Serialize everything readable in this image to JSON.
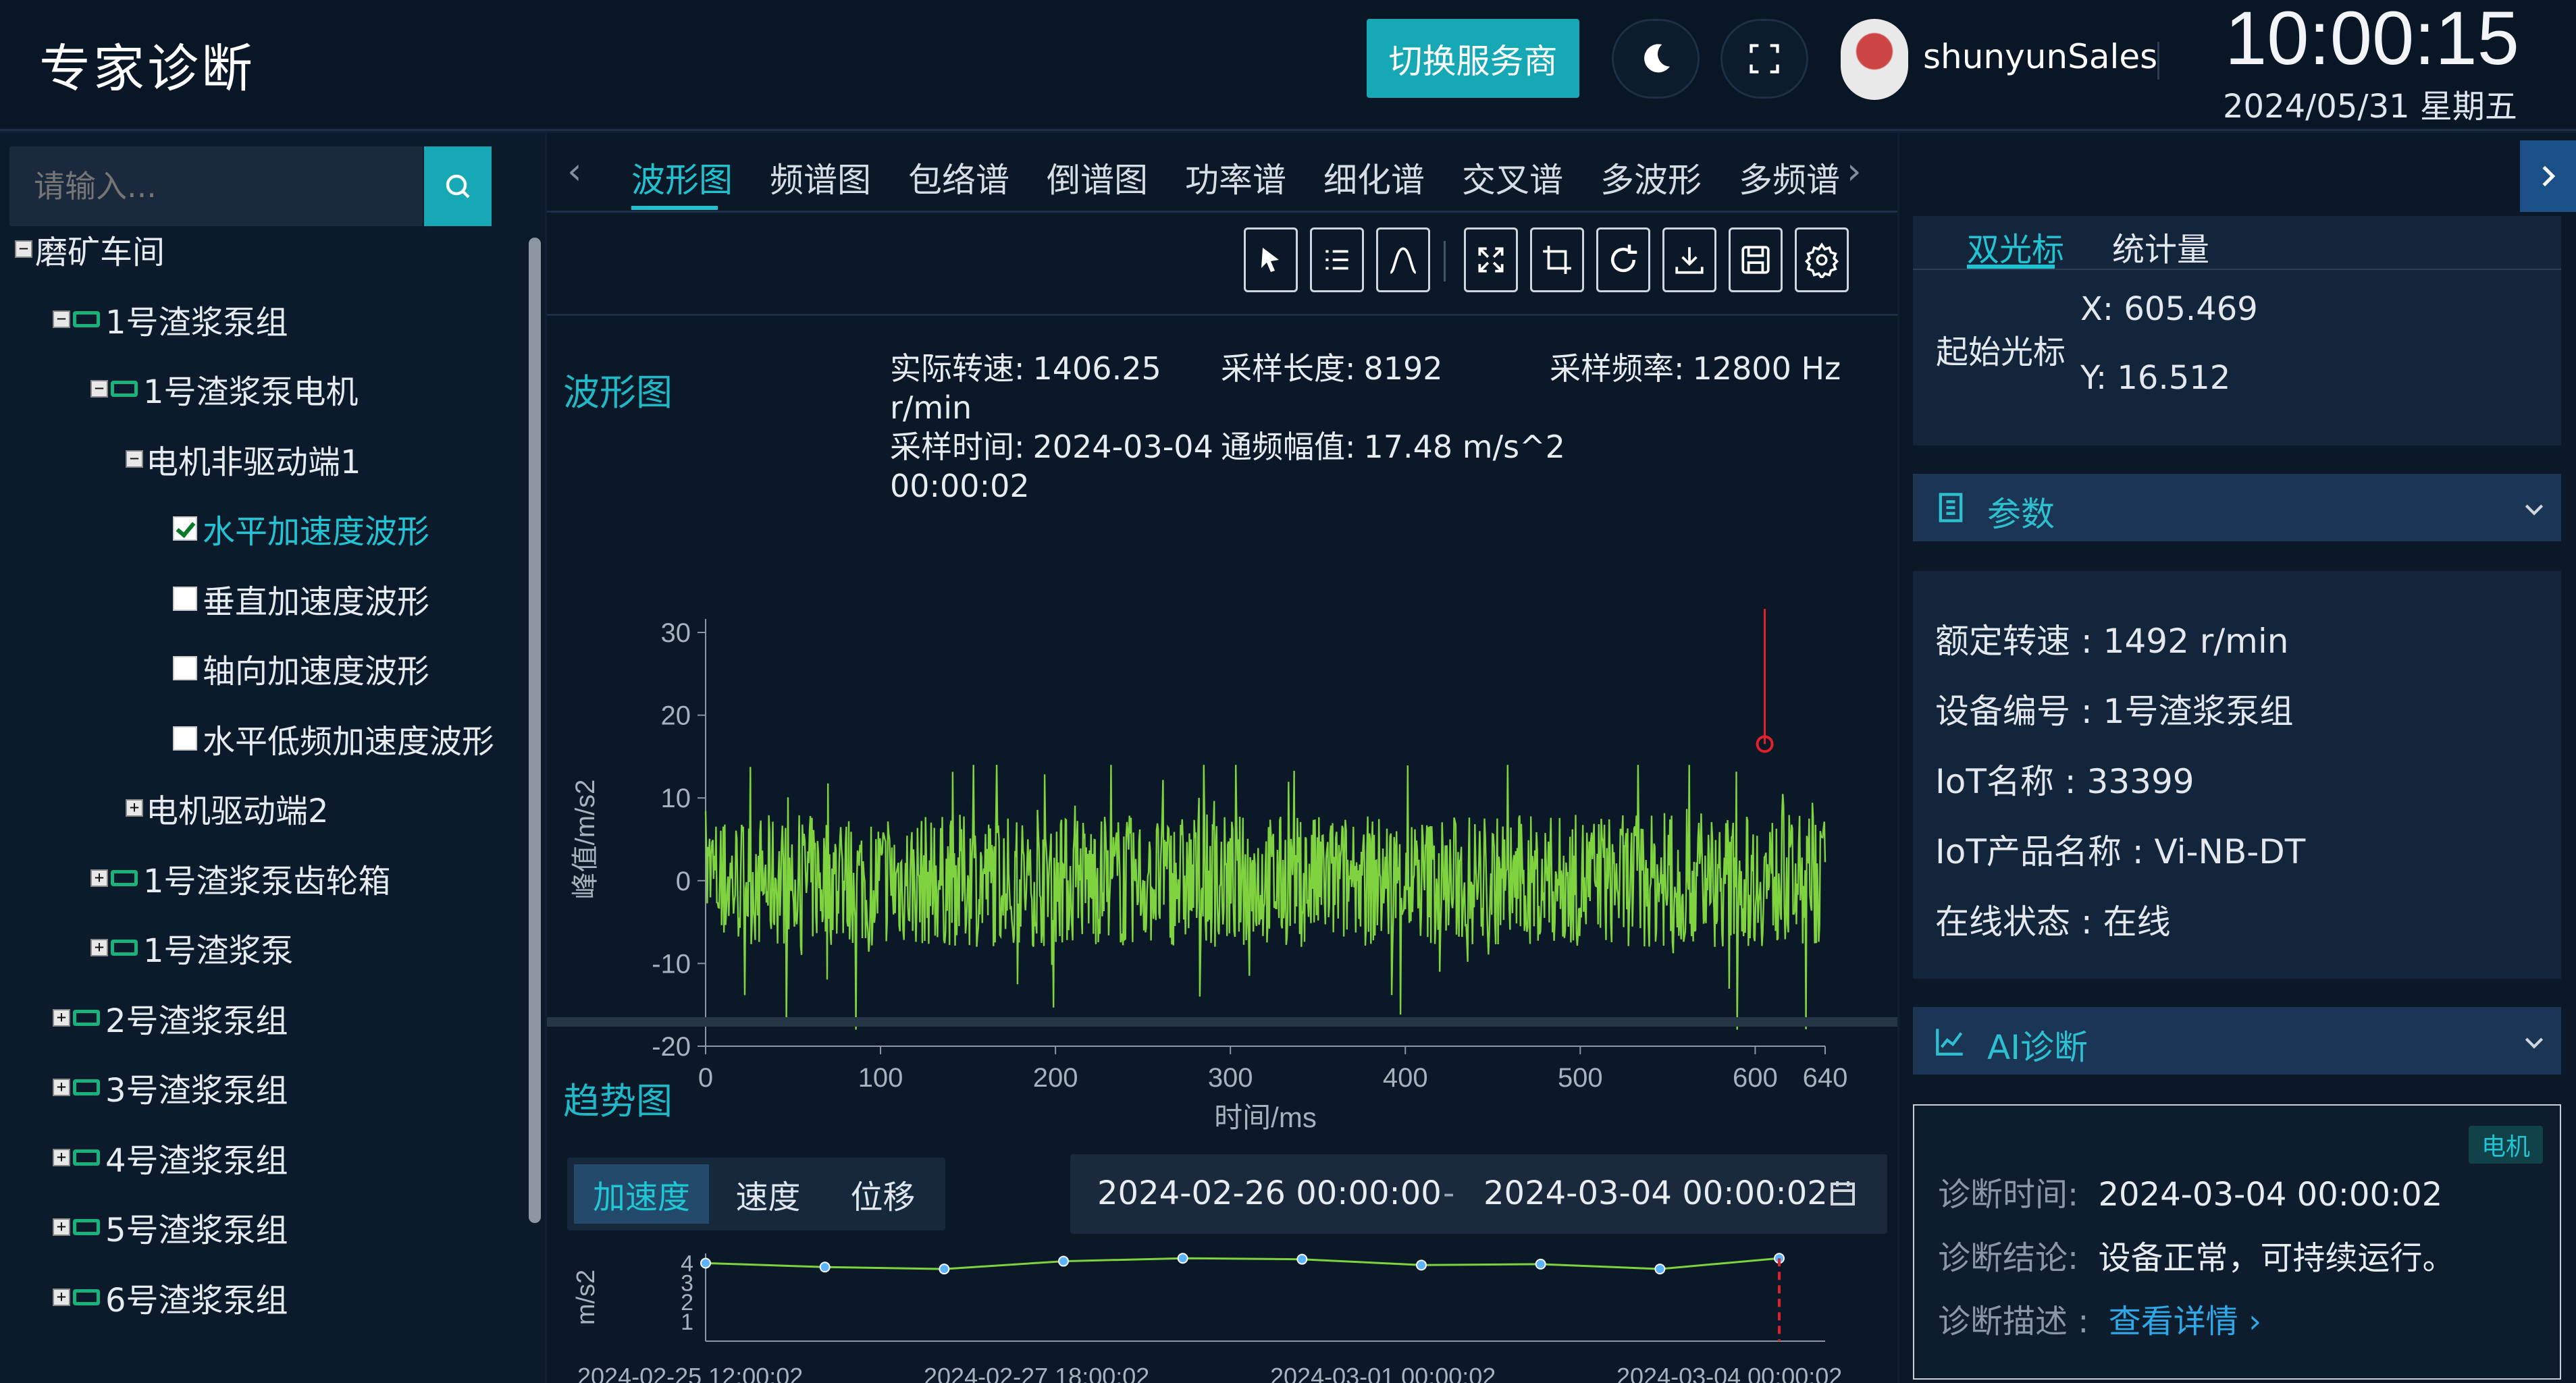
{
  "app": {
    "title": "专家诊断"
  },
  "header": {
    "switch_provider": "切换服务商",
    "username": "shunyunSales",
    "time": "10:00:15",
    "date": "2024/05/31 星期五"
  },
  "sidebar": {
    "search_placeholder": "请输入...",
    "tree": [
      {
        "label": "磨矿车间",
        "level": 0,
        "toggle": "−"
      },
      {
        "label": "1号渣浆泵组",
        "level": 1,
        "toggle": "−",
        "icon": "motor-icon"
      },
      {
        "label": "1号渣浆泵电机",
        "level": 2,
        "toggle": "−",
        "icon": "motor-icon"
      },
      {
        "label": "电机非驱动端1",
        "level": 3,
        "toggle": "−"
      },
      {
        "label": "水平加速度波形",
        "level": 4,
        "checked": true
      },
      {
        "label": "垂直加速度波形",
        "level": 4,
        "checked": false
      },
      {
        "label": "轴向加速度波形",
        "level": 4,
        "checked": false
      },
      {
        "label": "水平低频加速度波形",
        "level": 4,
        "checked": false
      },
      {
        "label": "电机驱动端2",
        "level": 3,
        "toggle": "+"
      },
      {
        "label": "1号渣浆泵齿轮箱",
        "level": 2,
        "toggle": "+",
        "icon": "motor-icon"
      },
      {
        "label": "1号渣浆泵",
        "level": 2,
        "toggle": "+",
        "icon": "motor-icon"
      },
      {
        "label": "2号渣浆泵组",
        "level": 1,
        "toggle": "+",
        "icon": "motor-icon"
      },
      {
        "label": "3号渣浆泵组",
        "level": 1,
        "toggle": "+",
        "icon": "motor-icon"
      },
      {
        "label": "4号渣浆泵组",
        "level": 1,
        "toggle": "+",
        "icon": "motor-icon"
      },
      {
        "label": "5号渣浆泵组",
        "level": 1,
        "toggle": "+",
        "icon": "motor-icon"
      },
      {
        "label": "6号渣浆泵组",
        "level": 1,
        "toggle": "+",
        "icon": "motor-icon"
      }
    ]
  },
  "tabs": [
    "波形图",
    "频谱图",
    "包络谱",
    "倒谱图",
    "功率谱",
    "细化谱",
    "交叉谱",
    "多波形",
    "多频谱"
  ],
  "toolbar": [
    "pointer-icon",
    "list-icon",
    "peak-icon",
    "fullscreen-icon",
    "crop-icon",
    "refresh-icon",
    "download-icon",
    "save-icon",
    "settings-icon"
  ],
  "waveform": {
    "title": "波形图",
    "speed_label": "实际转速:",
    "speed_value": "1406.25",
    "speed_unit": "r/min",
    "length_label": "采样长度:",
    "length_value": "8192",
    "freq_label": "采样频率:",
    "freq_value": "12800 Hz",
    "time_label": "采样时间:",
    "time_value": "2024-03-04",
    "time_value2": "00:00:02",
    "amp_label": "通频幅值:",
    "amp_value": "17.48 m/s^2"
  },
  "trend": {
    "title": "趋势图",
    "tabs": [
      "加速度",
      "速度",
      "位移"
    ],
    "start": "2024-02-26 00:00:00",
    "dash": "-",
    "end": "2024-03-04 00:00:02"
  },
  "cursor_panel": {
    "tabs": [
      "双光标",
      "统计量"
    ],
    "label": "起始光标",
    "x": "X: 605.469",
    "y": "Y: 16.512"
  },
  "params": {
    "title": "参数",
    "rows": [
      "额定转速 : 1492 r/min",
      "设备编号 : 1号渣浆泵组",
      "IoT名称 : 33399",
      "IoT产品名称 : Vi-NB-DT",
      "在线状态 : 在线"
    ]
  },
  "ai": {
    "title": "AI诊断",
    "tag": "电机",
    "time_label": "诊断时间:",
    "time_value": "2024-03-04 00:00:02",
    "result_label": "诊断结论:",
    "result_value": "设备正常，可持续运行。",
    "desc_label": "诊断描述 :",
    "desc_link": "查看详情 ›"
  },
  "colors": {
    "accent": "#20c2d0",
    "wave": "#7ed33f",
    "marker": "#e0202a",
    "background": "#0a1827"
  },
  "chart_data": [
    {
      "type": "line",
      "name": "waveform",
      "xlabel": "时间/ms",
      "ylabel": "峰值/m/s2",
      "xlim": [
        0,
        640
      ],
      "ylim": [
        -20,
        30
      ],
      "xticks": [
        "0",
        "100",
        "200",
        "300",
        "400",
        "500",
        "600",
        "640"
      ],
      "yticks": [
        "30",
        "20",
        "10",
        "0",
        "-10",
        "-20"
      ],
      "envelope_pos": 10,
      "envelope_neg": -10,
      "cursor": {
        "x": 605.469,
        "y": 16.512
      }
    },
    {
      "type": "line",
      "name": "trend",
      "ylabel": "m/s2",
      "yticks": [
        "4",
        "3",
        "2",
        "1"
      ],
      "xticks": [
        "2024-02-25 12:00:02",
        "2024-02-27 18:00:02",
        "2024-03-01 00:00:02",
        "2024-03-04 00:00:02"
      ],
      "values": [
        4.0,
        3.8,
        3.7,
        4.1,
        4.25,
        4.2,
        3.9,
        3.95,
        3.7,
        4.25
      ]
    }
  ]
}
